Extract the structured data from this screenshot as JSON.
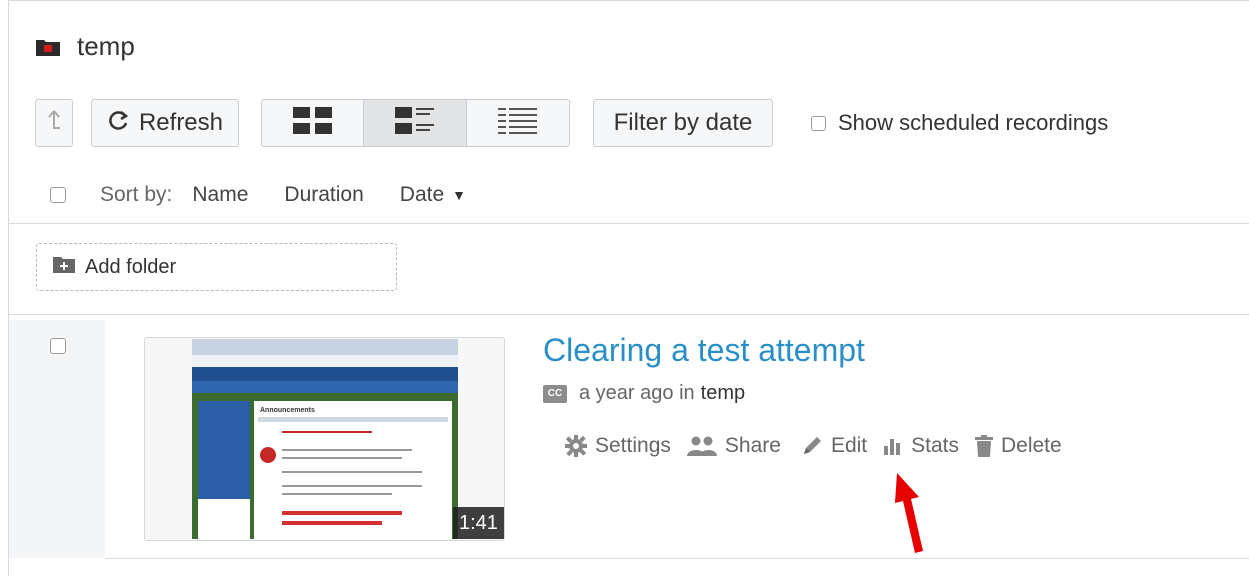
{
  "folder": {
    "title": "temp"
  },
  "toolbar": {
    "refresh_label": "Refresh",
    "filter_label": "Filter by date",
    "scheduled_label": "Show scheduled recordings"
  },
  "sort": {
    "label": "Sort by:",
    "options": [
      "Name",
      "Duration",
      "Date"
    ],
    "active": "Date",
    "direction": "descending"
  },
  "add_folder_label": "Add folder",
  "recording": {
    "title": "Clearing a test attempt",
    "caption_badge": "CC",
    "age": "a year ago in",
    "folder": "temp",
    "duration": "1:41",
    "thumbnail_heading": "Announcements"
  },
  "actions": {
    "settings": "Settings",
    "share": "Share",
    "edit": "Edit",
    "stats": "Stats",
    "delete": "Delete"
  },
  "colors": {
    "link": "#2a8fc9",
    "annotation_arrow": "#e60000",
    "folder_icon_accent": "#d81b1b"
  },
  "icons": [
    "folder-icon",
    "up-arrow-icon",
    "refresh-icon",
    "grid-view-icon",
    "list-view-icon",
    "detail-view-icon",
    "add-folder-icon",
    "cc-icon",
    "gear-icon",
    "people-icon",
    "pencil-icon",
    "bar-chart-icon",
    "trash-icon"
  ]
}
